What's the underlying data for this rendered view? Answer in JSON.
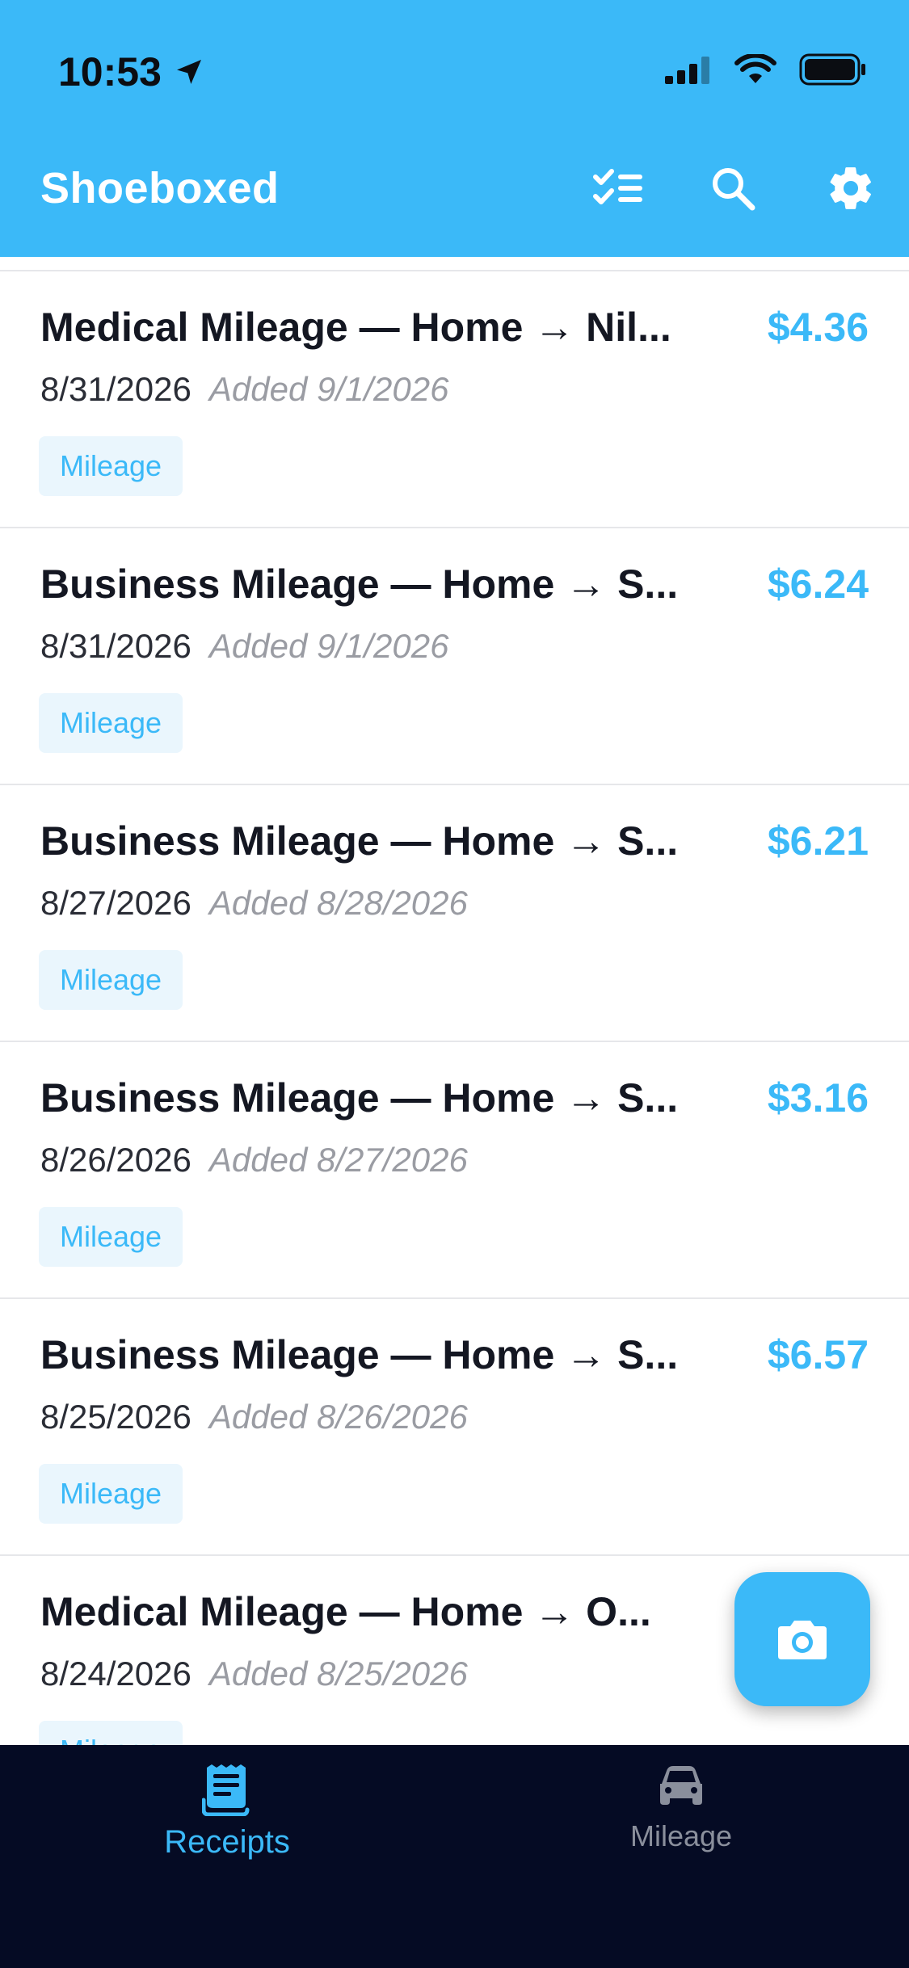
{
  "status_bar": {
    "time": "10:53"
  },
  "header": {
    "title": "Shoeboxed"
  },
  "receipts": [
    {
      "title": "Medical Mileage — Home → Nil...",
      "amount": "$4.36",
      "date": "8/31/2026",
      "added": "Added 9/1/2026",
      "tag": "Mileage"
    },
    {
      "title": "Business Mileage — Home → S...",
      "amount": "$6.24",
      "date": "8/31/2026",
      "added": "Added 9/1/2026",
      "tag": "Mileage"
    },
    {
      "title": "Business Mileage — Home → S...",
      "amount": "$6.21",
      "date": "8/27/2026",
      "added": "Added 8/28/2026",
      "tag": "Mileage"
    },
    {
      "title": "Business Mileage — Home → S...",
      "amount": "$3.16",
      "date": "8/26/2026",
      "added": "Added 8/27/2026",
      "tag": "Mileage"
    },
    {
      "title": "Business Mileage — Home → S...",
      "amount": "$6.57",
      "date": "8/25/2026",
      "added": "Added 8/26/2026",
      "tag": "Mileage"
    },
    {
      "title": "Medical Mileage — Home → O...",
      "amount": "",
      "date": "8/24/2026",
      "added": "Added 8/25/2026",
      "tag": "Mileage"
    }
  ],
  "bottom_nav": {
    "receipts_label": "Receipts",
    "mileage_label": "Mileage"
  },
  "icons": {
    "location": "location-arrow-icon",
    "signal": "cellular-signal-icon",
    "wifi": "wifi-icon",
    "battery": "battery-icon",
    "select": "checklist-icon",
    "search": "search-icon",
    "settings": "gear-icon",
    "camera": "camera-icon",
    "receipt": "receipt-icon",
    "car": "car-icon"
  },
  "colors": {
    "accent": "#3bb9f8",
    "nav_bg": "#050b24",
    "tag_bg": "#eaf6fd"
  }
}
